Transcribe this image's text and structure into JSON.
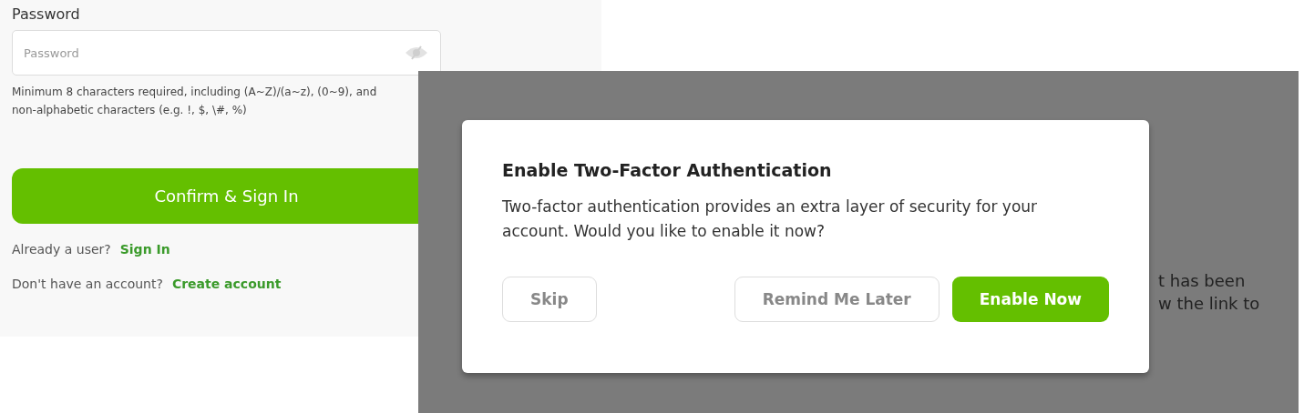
{
  "signup_form": {
    "password_label": "Password",
    "password_field": {
      "placeholder": "Password"
    },
    "password_hint": "Minimum 8 characters required, including (A~Z)/(a~z), (0~9), and non-alphabetic characters (e.g. !, $, \\#, %)",
    "confirm_button": "Confirm & Sign In",
    "links": [
      {
        "prompt": "Already a user?",
        "link": "Sign In"
      },
      {
        "prompt": "Don't have an account?",
        "link": "Create account"
      }
    ]
  },
  "background_text": [
    "t has been",
    "w the link to"
  ],
  "dialog": {
    "title": "Enable Two-Factor Authentication",
    "message": "Two-factor authentication provides an extra layer of security for your account. Would you like to enable it now?",
    "buttons": [
      {
        "label": "Skip",
        "kind": "outline"
      },
      {
        "label": "Remind Me Later",
        "kind": "outline"
      },
      {
        "label": "Enable Now",
        "kind": "primary"
      }
    ]
  }
}
